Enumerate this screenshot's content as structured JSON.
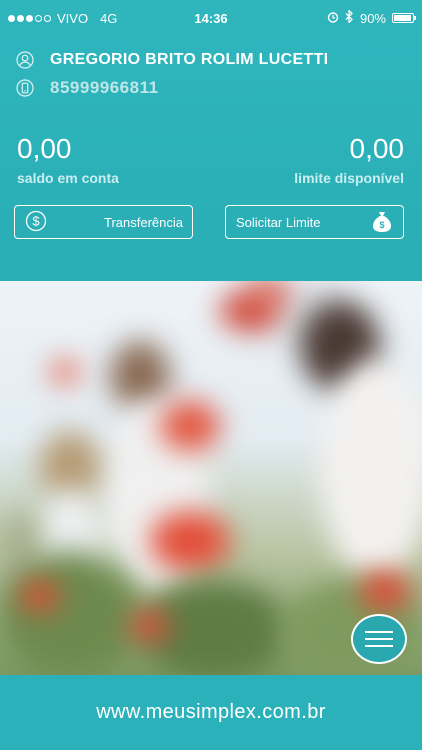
{
  "status_bar": {
    "carrier": "VIVO",
    "network": "4G",
    "time": "14:36",
    "battery": "90%",
    "battery_level": 0.9
  },
  "user": {
    "name": "GREGORIO BRITO ROLIM LUCETTI",
    "phone": "85999966811"
  },
  "balance": {
    "value": "0,00",
    "label": "saldo em conta"
  },
  "limit": {
    "value": "0,00",
    "label": "limite disponível"
  },
  "buttons": {
    "transfer": "Transferência",
    "request_limit": "Solicitar Limite"
  },
  "icons": [
    "user-icon",
    "phone-icon",
    "dollar-circle-icon",
    "money-bag-icon",
    "hamburger-menu-icon",
    "alarm-icon",
    "bluetooth-icon",
    "battery-icon"
  ],
  "colors": {
    "brand": "#2bb1b9",
    "label": "#c9eef0"
  },
  "footer": {
    "url": "www.meusimplex.com.br"
  }
}
